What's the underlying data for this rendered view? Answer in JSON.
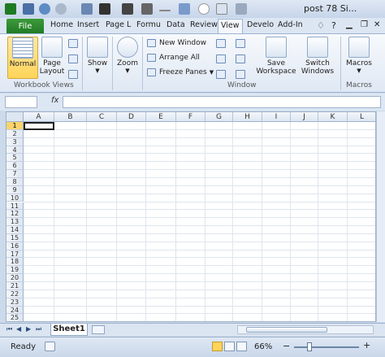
{
  "window": {
    "title": "post 78 Si..."
  },
  "quick_access": [
    "excel-logo-icon",
    "save-icon",
    "undo-icon",
    "redo-icon",
    "shapes-icon",
    "freeze-icon",
    "table-icon",
    "camera-icon",
    "line-icon",
    "chart-icon",
    "circle-icon",
    "copy-icon",
    "dropdown-icon"
  ],
  "ribbon_tabs": {
    "file": "File",
    "items": [
      {
        "label": "Home"
      },
      {
        "label": "Insert"
      },
      {
        "label": "Page L"
      },
      {
        "label": "Formu"
      },
      {
        "label": "Data"
      },
      {
        "label": "Review"
      },
      {
        "label": "View",
        "active": true
      },
      {
        "label": "Develo"
      },
      {
        "label": "Add-In"
      }
    ]
  },
  "ribbon": {
    "workbook_views": {
      "label": "Workbook Views",
      "normal": "Normal",
      "page_layout_line1": "Page",
      "page_layout_line2": "Layout"
    },
    "show": {
      "label": "Show"
    },
    "zoom": {
      "label": "Zoom"
    },
    "window": {
      "label": "Window",
      "new_window": "New Window",
      "arrange_all": "Arrange All",
      "freeze_panes": "Freeze Panes",
      "save_workspace_line1": "Save",
      "save_workspace_line2": "Workspace",
      "switch_windows_line1": "Switch",
      "switch_windows_line2": "Windows"
    },
    "macros": {
      "label": "Macros",
      "button": "Macros"
    }
  },
  "formula_bar": {
    "fx": "fx",
    "value": ""
  },
  "grid": {
    "columns": [
      "A",
      "B",
      "C",
      "D",
      "E",
      "F",
      "G",
      "H",
      "I",
      "J",
      "K",
      "L"
    ],
    "rows": [
      "1",
      "2",
      "3",
      "4",
      "5",
      "6",
      "7",
      "8",
      "9",
      "10",
      "11",
      "12",
      "13",
      "14",
      "15",
      "16",
      "17",
      "18",
      "19",
      "20",
      "21",
      "22",
      "23",
      "24",
      "25"
    ],
    "active_row": "1"
  },
  "sheets": {
    "tabs": [
      "Sheet1"
    ],
    "active": "Sheet1"
  },
  "status": {
    "ready": "Ready",
    "zoom": "66%"
  },
  "colors": {
    "accent": "#1f7a24",
    "selection": "#f8d46b"
  }
}
